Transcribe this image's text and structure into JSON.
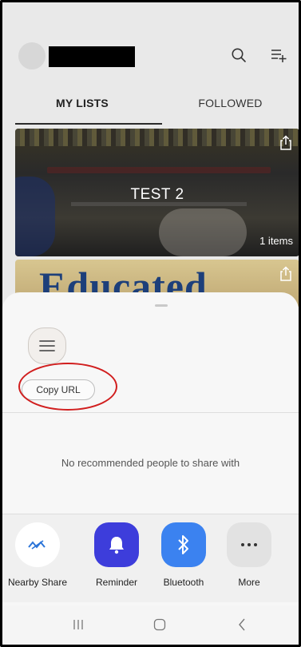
{
  "header": {
    "search_icon": "search-icon",
    "add_list_icon": "add-list-icon"
  },
  "tabs": [
    {
      "label": "MY LISTS",
      "active": true
    },
    {
      "label": "FOLLOWED",
      "active": false
    }
  ],
  "lists": [
    {
      "title": "TEST 2",
      "count": "1 items"
    },
    {
      "title": "",
      "count": ""
    }
  ],
  "share_sheet": {
    "copy_url_label": "Copy URL",
    "no_recommendation_text": "No recommended people to share with",
    "apps": [
      {
        "label": "Nearby Share",
        "icon": "nearby-share-icon",
        "color": "#ffffff"
      },
      {
        "label": "Reminder",
        "icon": "bell-icon",
        "color": "#3d3ddb"
      },
      {
        "label": "Bluetooth",
        "icon": "bluetooth-icon",
        "color": "#3b82f0"
      },
      {
        "label": "More",
        "icon": "more-icon",
        "color": "#e2e2e2"
      }
    ]
  },
  "colors": {
    "highlight": "#d11e1e",
    "sheet_bg": "#f7f7f7",
    "app_bg": "#e9e9e9"
  }
}
